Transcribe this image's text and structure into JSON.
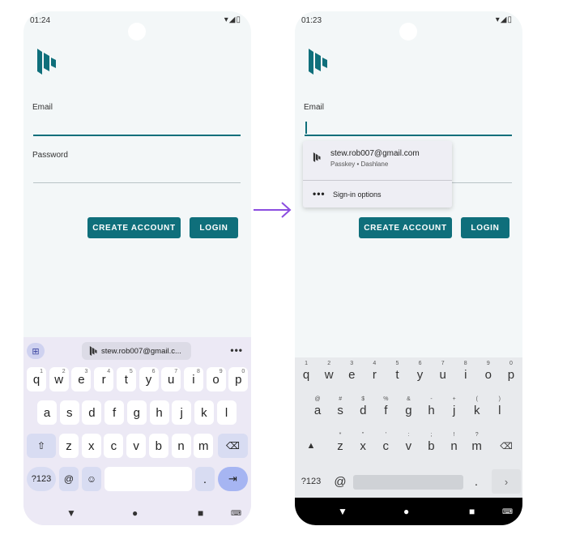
{
  "arrow_color": "#8b4de0",
  "accent": "#0f6f7b",
  "left_phone": {
    "status": {
      "time": "01:24",
      "icons": "▾◢▯"
    },
    "email_label": "Email",
    "password_label": "Password",
    "create_account": "CREATE ACCOUNT",
    "login": "LOGIN",
    "keyboard": {
      "apps_icon": "⊞",
      "suggestion": "stew.rob007@gmail.c...",
      "more": "•••",
      "row1": [
        [
          "q",
          "1"
        ],
        [
          "w",
          "2"
        ],
        [
          "e",
          "3"
        ],
        [
          "r",
          "4"
        ],
        [
          "t",
          "5"
        ],
        [
          "y",
          "6"
        ],
        [
          "u",
          "7"
        ],
        [
          "i",
          "8"
        ],
        [
          "o",
          "9"
        ],
        [
          "p",
          "0"
        ]
      ],
      "row2": [
        "a",
        "s",
        "d",
        "f",
        "g",
        "h",
        "j",
        "k",
        "l"
      ],
      "row3": [
        "z",
        "x",
        "c",
        "v",
        "b",
        "n",
        "m"
      ],
      "shift": "⇧",
      "backspace": "⌫",
      "symbols": "?123",
      "at": "@",
      "emoji": "☺",
      "period": ".",
      "enter": "⇥"
    },
    "nav": {
      "back": "▼",
      "home": "●",
      "recents": "■",
      "keyboard": "⌨"
    }
  },
  "right_phone": {
    "status": {
      "time": "01:23",
      "icons": "▾◢▯"
    },
    "email_label": "Email",
    "autofill": {
      "email": "stew.rob007@gmail.com",
      "subtitle": "Passkey • Dashlane",
      "options_icon": "•••",
      "options_label": "Sign-in options"
    },
    "create_account": "CREATE ACCOUNT",
    "login": "LOGIN",
    "keyboard": {
      "row1": [
        [
          "q",
          "1"
        ],
        [
          "w",
          "2"
        ],
        [
          "e",
          "3"
        ],
        [
          "r",
          "4"
        ],
        [
          "t",
          "5"
        ],
        [
          "y",
          "6"
        ],
        [
          "u",
          "7"
        ],
        [
          "i",
          "8"
        ],
        [
          "o",
          "9"
        ],
        [
          "p",
          "0"
        ]
      ],
      "row2": [
        [
          "a",
          "@"
        ],
        [
          "s",
          "#"
        ],
        [
          "d",
          "$"
        ],
        [
          "f",
          "%"
        ],
        [
          "g",
          "&"
        ],
        [
          "h",
          "-"
        ],
        [
          "j",
          "+"
        ],
        [
          "k",
          "("
        ],
        [
          "l",
          ")"
        ]
      ],
      "row3": [
        [
          "z",
          "*"
        ],
        [
          "x",
          "\""
        ],
        [
          "c",
          "'"
        ],
        [
          "v",
          ":"
        ],
        [
          "b",
          ";"
        ],
        [
          "n",
          "!"
        ],
        [
          "m",
          "?"
        ]
      ],
      "shift": "▲",
      "backspace": "⌫",
      "symbols": "?123",
      "at": "@",
      "period": ".",
      "go": "›"
    },
    "nav": {
      "back": "▼",
      "home": "●",
      "recents": "■",
      "keyboard": "⌨"
    }
  }
}
